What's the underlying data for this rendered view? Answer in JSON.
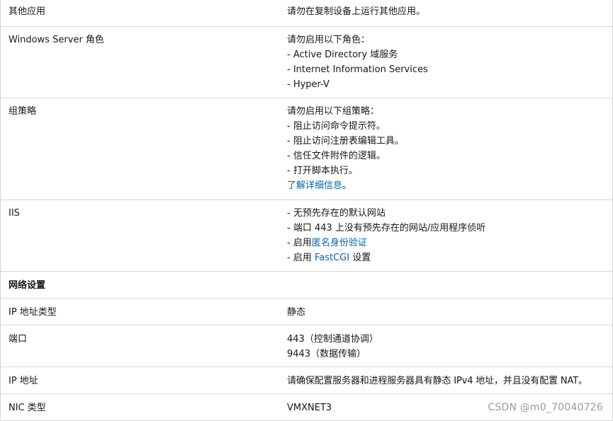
{
  "rows": [
    {
      "label": "其他应用",
      "lines": [
        "请勿在复制设备上运行其他应用。"
      ]
    },
    {
      "label": "Windows Server 角色",
      "lines": [
        "请勿启用以下角色：",
        "- Active Directory 域服务",
        "- Internet Information Services",
        "- Hyper-V"
      ]
    },
    {
      "label": "组策略",
      "lines": [
        "请勿启用以下组策略：",
        "- 阻止访问命令提示符。",
        "- 阻止访问注册表编辑工具。",
        "- 信任文件附件的逻辑。",
        "- 打开脚本执行。"
      ],
      "link": "了解详细信息",
      "link_suffix": "。"
    },
    {
      "label": "IIS",
      "lines": [
        "- 无预先存在的默认网站",
        "- 端口 443 上没有预先存在的网站/应用程序侦听"
      ],
      "anon_prefix": "- 启用",
      "anon_link": "匿名身份验证",
      "fcgi_prefix": "- 启用 ",
      "fcgi_link": "FastCGI",
      "fcgi_suffix": " 设置"
    }
  ],
  "network_section": {
    "title": "网络设置"
  },
  "net_rows": [
    {
      "label": "IP 地址类型",
      "lines": [
        "静态"
      ]
    },
    {
      "label": "端口",
      "lines": [
        "443（控制通道协调）",
        "9443（数据传输）"
      ]
    },
    {
      "label": "IP 地址",
      "lines": [
        "请确保配置服务器和进程服务器具有静态 IPv4 地址，并且没有配置 NAT。"
      ]
    },
    {
      "label": "NIC 类型",
      "lines": [
        "VMXNET3"
      ]
    }
  ],
  "watermark": "CSDN @m0_70040726",
  "colors": {
    "link": "#0065b3",
    "border": "#d6d6d6",
    "text": "#171717"
  }
}
